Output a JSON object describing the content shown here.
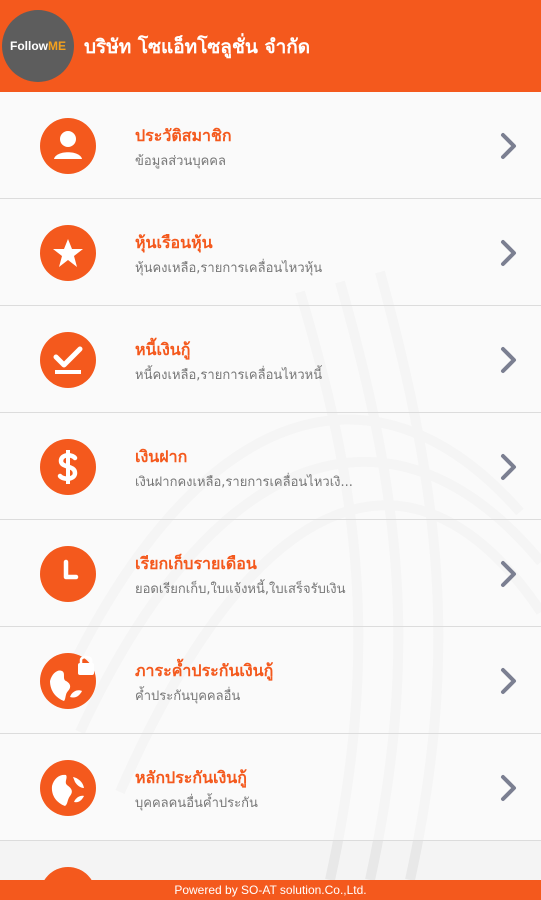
{
  "header": {
    "logo_text": "Follow",
    "logo_accent": "ME",
    "title": "บริษัท โซแอ็ทโซลูชั่น จำกัด"
  },
  "colors": {
    "brand": "#f4591d",
    "chevron": "#7b7f91"
  },
  "menu": {
    "items": [
      {
        "title": "ประวัติสมาชิก",
        "subtitle": "ข้อมูลส่วนบุคคล",
        "icon": "user-icon"
      },
      {
        "title": "หุ้นเรือนหุ้น",
        "subtitle": "หุ้นคงเหลือ,รายการเคลื่อนไหวหุ้น",
        "icon": "star-icon"
      },
      {
        "title": "หนี้เงินกู้",
        "subtitle": "หนี้คงเหลือ,รายการเคลื่อนไหวหนี้",
        "icon": "check-icon"
      },
      {
        "title": "เงินฝาก",
        "subtitle": "เงินฝากคงเหลือ,รายการเคลื่อนไหวเงิ...",
        "icon": "dollar-icon"
      },
      {
        "title": "เรียกเก็บรายเดือน",
        "subtitle": "ยอดเรียกเก็บ,ใบแจ้งหนี้,ใบเสร็จรับเงิน",
        "icon": "clock-icon"
      },
      {
        "title": "ภาระค้ำประกันเงินกู้",
        "subtitle": "ค้ำประกันบุคคลอื่น",
        "icon": "globe-lock-icon"
      },
      {
        "title": "หลักประกันเงินกู้",
        "subtitle": "บุคคลคนอื่นค้ำประกัน",
        "icon": "globe-icon"
      }
    ]
  },
  "footer": {
    "text": "Powered by SO-AT solution.Co.,Ltd."
  }
}
